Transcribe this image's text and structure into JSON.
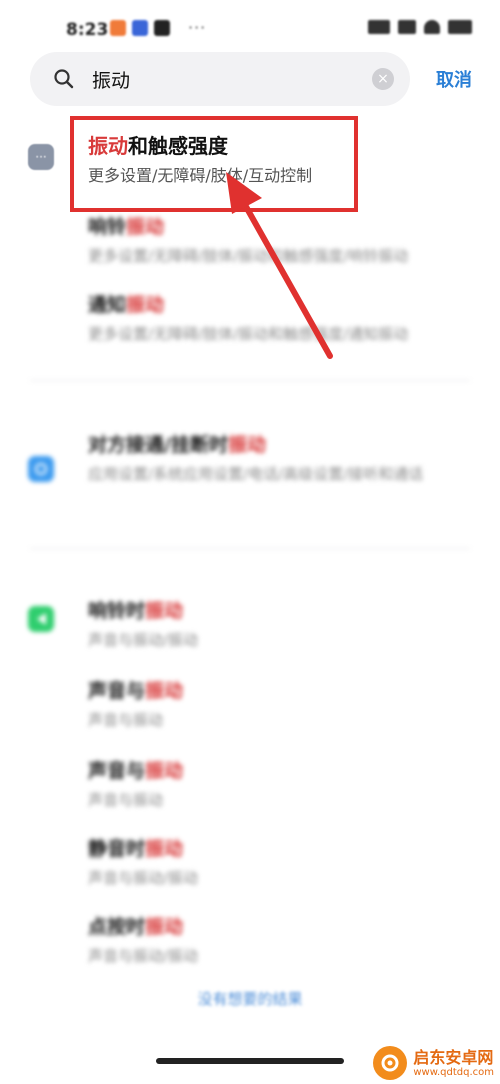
{
  "status_bar": {
    "time": "8:23",
    "dots": "···"
  },
  "search": {
    "query": "振动",
    "cancel_label": "取消",
    "clear_glyph": "×"
  },
  "results": [
    {
      "highlight": "振动",
      "rest": "和触感强度",
      "path": "更多设置/无障碍/肢体/互动控制",
      "icon_color": "#8a94a6"
    },
    {
      "prefix": "响铃",
      "highlight": "振动",
      "path": "更多设置/无障碍/肢体/振动和触感强度/响铃振动"
    },
    {
      "prefix": "通知",
      "highlight": "振动",
      "path": "更多设置/无障碍/肢体/振动和触感强度/通知振动"
    },
    {
      "prefix": "对方接通/挂断时",
      "highlight": "振动",
      "path": "应用设置/系统应用设置/电话/高级设置/接听和通话",
      "icon_color": "#3d9bef"
    },
    {
      "prefix": "响铃时",
      "highlight": "振动",
      "path": "声音与振动/振动",
      "icon_color": "#2fce6e"
    },
    {
      "prefix": "声音与",
      "highlight": "振动",
      "path": "声音与振动"
    },
    {
      "prefix": "声音与",
      "highlight": "振动",
      "path": "声音与振动"
    },
    {
      "prefix": "静音时",
      "highlight": "振动",
      "path": "声音与振动/振动"
    },
    {
      "prefix": "点按时",
      "highlight": "振动",
      "path": "声音与振动/振动"
    }
  ],
  "footer": {
    "no_result_link": "没有想要的结果"
  },
  "watermark": {
    "name": "启东安卓网",
    "url": "www.qdtdq.com"
  },
  "colors": {
    "highlight_red": "#d83a3a",
    "annotation_red": "#e0312f",
    "accent_blue": "#2a7fd6"
  }
}
